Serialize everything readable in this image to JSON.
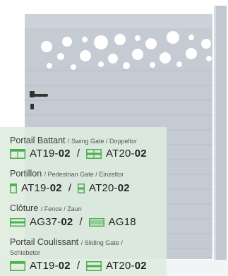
{
  "accent_color": "#4fae4f",
  "gate_color": "#c5cbd3",
  "products": [
    {
      "title": "Portail Battant",
      "subtitle": "/ Swing Gate / Doppeltor",
      "models": [
        {
          "icon": "double-panel-icon",
          "code": "AT19-",
          "bold": "02"
        },
        {
          "icon": "double-panel-split-icon",
          "code": "AT20-",
          "bold": "02"
        }
      ]
    },
    {
      "title": "Portillon",
      "subtitle": "/ Pedestrian Gate / Einzeltor",
      "models": [
        {
          "icon": "single-panel-icon",
          "code": "AT19-",
          "bold": "02"
        },
        {
          "icon": "single-panel-split-icon",
          "code": "AT20-",
          "bold": "02"
        }
      ]
    },
    {
      "title": "Clôture",
      "subtitle": "/ Fence / Zaun",
      "models": [
        {
          "icon": "fence-panel-icon",
          "code": "AG37-",
          "bold": "02"
        },
        {
          "icon": "fence-slat-icon",
          "code": "AG18",
          "bold": ""
        }
      ]
    },
    {
      "title": "Portail Coulissant",
      "subtitle": "/ Sliding Gate /",
      "subtitle2": "Schiebetor",
      "models": [
        {
          "icon": "sliding-panel-icon",
          "code": "AT19-",
          "bold": "02"
        },
        {
          "icon": "sliding-panel-split-icon",
          "code": "AT20-",
          "bold": "02"
        }
      ]
    }
  ],
  "separator": "/"
}
